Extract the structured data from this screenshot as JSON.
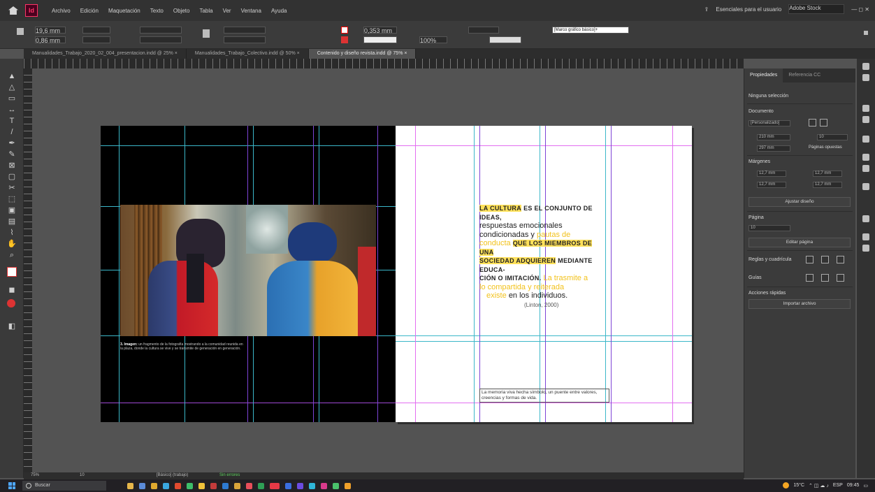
{
  "app": {
    "name": "InDesign",
    "logo_text": "Id"
  },
  "menubar": {
    "items": [
      "Archivo",
      "Edición",
      "Maquetación",
      "Texto",
      "Objeto",
      "Tabla",
      "Ver",
      "Ventana",
      "Ayuda"
    ],
    "workspace": "Esenciales para el usuario",
    "search_placeholder": "Adobe Stock"
  },
  "control": {
    "x": "19,6 mm",
    "y": "0,86 mm",
    "stroke_weight": "0,353 mm",
    "zoom": "100%",
    "style": "[Marco gráfico básico]+"
  },
  "tabs": [
    {
      "label": "Manualidades_Trabajo_2020_02_004_presentacion.indd @ 25% ×",
      "active": false
    },
    {
      "label": "Manualidades_Trabajo_Colectivo.indd @ 50% ×",
      "active": false
    },
    {
      "label": "Contenido y diseño revista.indd @ 75% ×",
      "active": true
    }
  ],
  "document": {
    "caption_bold": "3. Imagen:",
    "caption_text": "un fragmento de la fotografía mostrando a la comunidad reunida en la plaza, donde la cultura se vive y se transmite de generación en generación.",
    "quote": {
      "y1": "LA CULTURA",
      "b1": "ES EL CONJUNTO DE IDEAS,",
      "l2": "respuestas emocionales",
      "l3a": "condicionadas y",
      "l3b": "pautas de",
      "l4a": "conducta",
      "l4b": "QUE LOS MIEMBROS DE UNA",
      "l5a": "SOCIEDAD ADQUIEREN",
      "l5b": "MEDIANTE EDUCA-",
      "l6a": "CIÓN O IMITACIÓN.",
      "l6b": "La trasmite a",
      "l7": "lo compartida y reiterada",
      "l8a": "existe",
      "l8b": "en los individuos."
    },
    "citation": "(Linton, 2000)",
    "footnote": "La memoria viva hecha símbolo, un puente entre valores, creencias y formas de vida."
  },
  "panel": {
    "tabs": [
      "Propiedades",
      "Referencia CC"
    ],
    "subtitle": "Ninguna selección",
    "doc_label": "Documento",
    "preset": "[Personalizado]",
    "width": "210 mm",
    "height": "297 mm",
    "pages": "10",
    "facing": "Páginas opuestas",
    "margins_label": "Márgenes",
    "m_top": "12,7 mm",
    "m_bottom": "12,7 mm",
    "m_left": "12,7 mm",
    "m_right": "12,7 mm",
    "adjust_btn": "Ajustar diseño",
    "pages_label": "Página",
    "page_sel": "10",
    "edit_page_btn": "Editar página",
    "rulers_label": "Reglas y cuadrícula",
    "guides_label": "Guías",
    "quick_label": "Acciones rápidas",
    "import_btn": "Importar archivo"
  },
  "status": {
    "zoom": "75%",
    "page": "10",
    "style": "[Básico] (trabajo)",
    "errors": "Sin errores"
  },
  "taskbar": {
    "search": "Buscar",
    "weather": "15°C",
    "lang": "ESP",
    "time": "09:45"
  }
}
